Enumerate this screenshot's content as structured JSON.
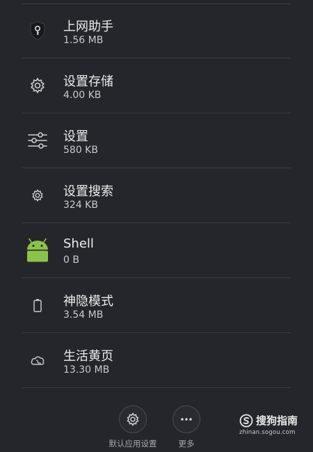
{
  "apps": [
    {
      "name": "上网助手",
      "size": "1.56 MB",
      "icon": "shield-key-icon"
    },
    {
      "name": "设置存储",
      "size": "4.00 KB",
      "icon": "gear-icon"
    },
    {
      "name": "设置",
      "size": "580 KB",
      "icon": "sliders-icon"
    },
    {
      "name": "设置搜索",
      "size": "324 KB",
      "icon": "small-gear-icon"
    },
    {
      "name": "Shell",
      "size": "0 B",
      "icon": "android-icon"
    },
    {
      "name": "神隐模式",
      "size": "3.54 MB",
      "icon": "battery-icon"
    },
    {
      "name": "生活黄页",
      "size": "13.30 MB",
      "icon": "cloud-phone-icon"
    }
  ],
  "bottom_actions": {
    "default_settings": {
      "label": "默认应用设置",
      "icon": "gear-icon"
    },
    "more": {
      "label": "更多",
      "icon": "more-dots-icon"
    }
  },
  "watermark": {
    "brand": "搜狗指南",
    "url": "zhinan.sogou.com"
  },
  "colors": {
    "background": "#25262b",
    "divider": "#3a3b41",
    "android_green": "#8bc34a"
  }
}
